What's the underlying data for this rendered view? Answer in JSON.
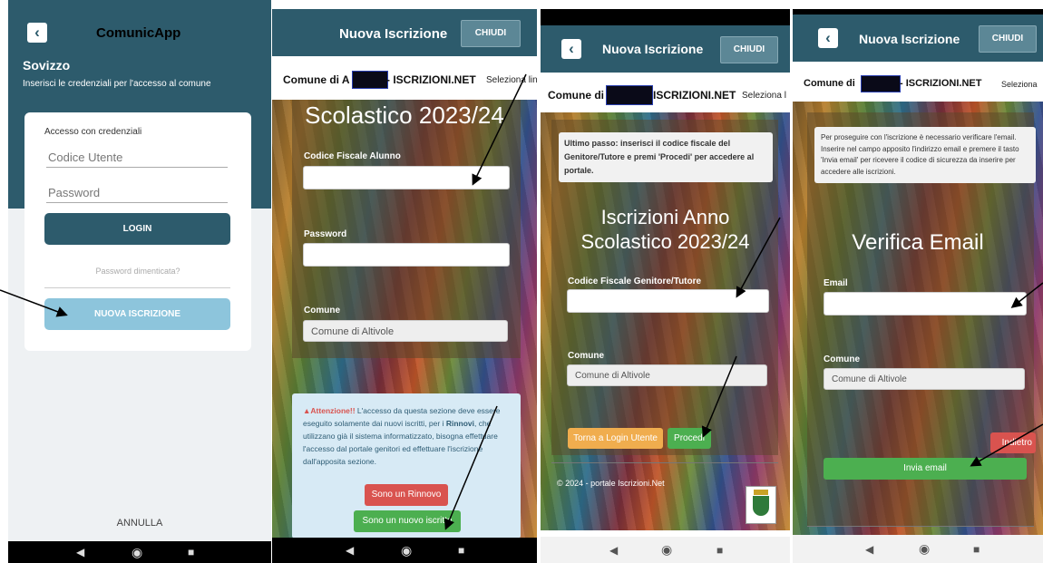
{
  "screen1": {
    "header_title": "ComunicApp",
    "municipality": "Sovizzo",
    "subtitle": "Inserisci le credenziali per l'accesso al comune",
    "card_title": "Accesso con credenziali",
    "username_placeholder": "Codice Utente",
    "password_placeholder": "Password",
    "login_label": "LOGIN",
    "forgot_label": "Password dimenticata?",
    "new_registration_label": "NUOVA ISCRIZIONE",
    "cancel_label": "ANNULLA"
  },
  "screen2": {
    "header_title": "Nuova Iscrizione",
    "close_label": "CHIUDI",
    "brand_prefix": "Comune di A",
    "brand_suffix": "- ISCRIZIONI.NET",
    "language_label": "Seleziona lin",
    "page_title": "Scolastico 2023/24",
    "tax_code_label": "Codice Fiscale Alunno",
    "password_label": "Password",
    "municipality_label": "Comune",
    "municipality_value": "Comune di Altivole",
    "warning_title": "Attenzione!!",
    "warning_text_1": " L'accesso da questa sezione deve essere eseguito solamente dai nuovi iscritti, per i ",
    "warning_bold": "Rinnovi",
    "warning_text_2": ", che utilizzano già il sistema informatizzato, bisogna effettuare l'accesso dal portale genitori ed effettuare l'iscrizione dall'apposita sezione.",
    "renewal_label": "Sono un Rinnovo",
    "new_label": "Sono un nuovo iscritto"
  },
  "screen3": {
    "header_title": "Nuova Iscrizione",
    "close_label": "CHIUDI",
    "brand_prefix": "Comune di",
    "brand_suffix": "ISCRIZIONI.NET",
    "language_label": "Seleziona l",
    "info_text": "Ultimo passo: inserisci il codice fiscale del Genitore/Tutore e premi 'Procedi' per accedere al portale.",
    "title_line1": "Iscrizioni Anno",
    "title_line2": "Scolastico 2023/24",
    "tax_code_label": "Codice Fiscale Genitore/Tutore",
    "municipality_label": "Comune",
    "municipality_value": "Comune di Altivole",
    "back_label": "Torna a Login Utente",
    "proceed_label": "Procedi",
    "footer_text": "© 2024 - portale Iscrizioni.Net"
  },
  "screen4": {
    "header_title": "Nuova Iscrizione",
    "close_label": "CHIUDI",
    "brand_prefix": "Comune di",
    "brand_suffix": "- ISCRIZIONI.NET",
    "language_label": "Seleziona",
    "info_text": "Per proseguire con l'iscrizione è necessario verificare l'email. Inserire nel campo apposito l'indirizzo email e premere il tasto 'Invia email' per ricevere il codice di sicurezza da inserire per accedere alle iscrizioni.",
    "page_title": "Verifica Email",
    "email_label": "Email",
    "municipality_label": "Comune",
    "municipality_value": "Comune di Altivole",
    "back_label": "Indietro",
    "send_label": "Invia email"
  },
  "nav": {
    "back_icon": "◀",
    "home_icon": "◉",
    "recents_icon": "■"
  },
  "colors": {
    "header": "#2d5b6c",
    "login_button": "#2d5b6c",
    "new_button": "#8dc5dc",
    "success": "#4caf50",
    "danger": "#d9534f",
    "warning": "#f0ad4e"
  }
}
